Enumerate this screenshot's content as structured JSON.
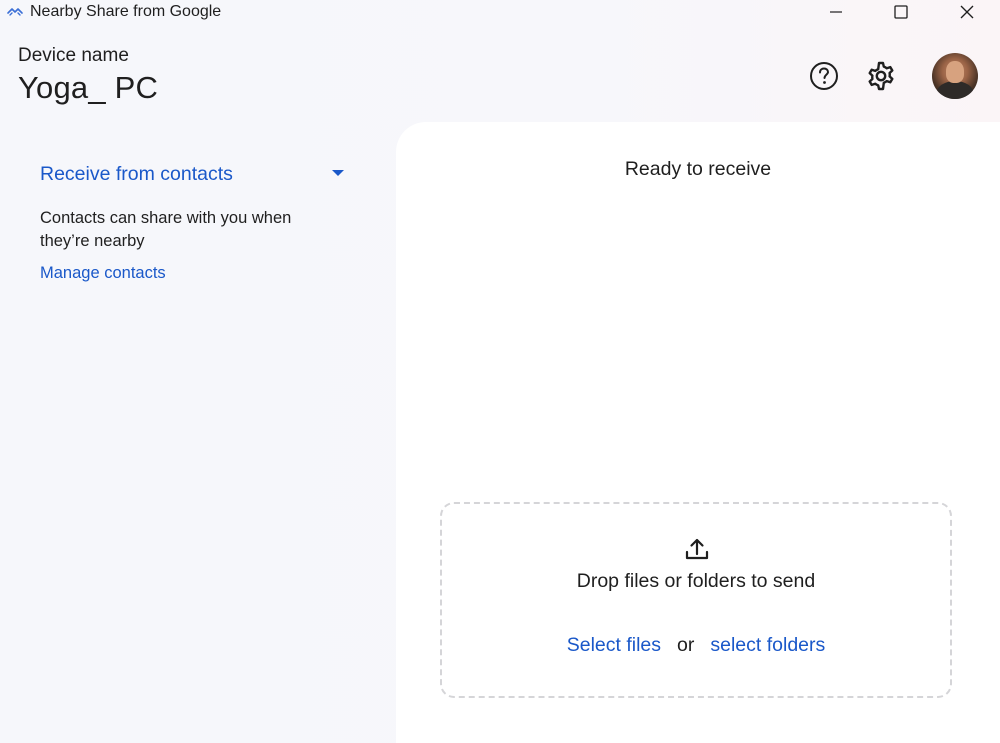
{
  "window": {
    "title": "Nearby Share from Google",
    "icons": {
      "app": "nearby-share-icon",
      "minimize": "minimize-icon",
      "maximize": "maximize-icon",
      "close": "close-icon"
    }
  },
  "header": {
    "device_label": "Device name",
    "device_name": "Yoga_ PC",
    "icons": {
      "help": "help-circle-icon",
      "settings": "gear-icon"
    }
  },
  "sidebar": {
    "receive_mode": "Receive from contacts",
    "receive_description": "Contacts can share with you when they’re nearby",
    "manage_contacts": "Manage contacts"
  },
  "main": {
    "status": "Ready to receive",
    "drop_zone": {
      "prompt": "Drop files or folders to send",
      "select_files": "Select files",
      "or": "or",
      "select_folders": "select folders"
    }
  },
  "colors": {
    "accent": "#1a58c9",
    "text": "#1f1f1f",
    "background": "#f7f7fb",
    "panel": "#ffffff",
    "dash_border": "#d5d5d8"
  }
}
